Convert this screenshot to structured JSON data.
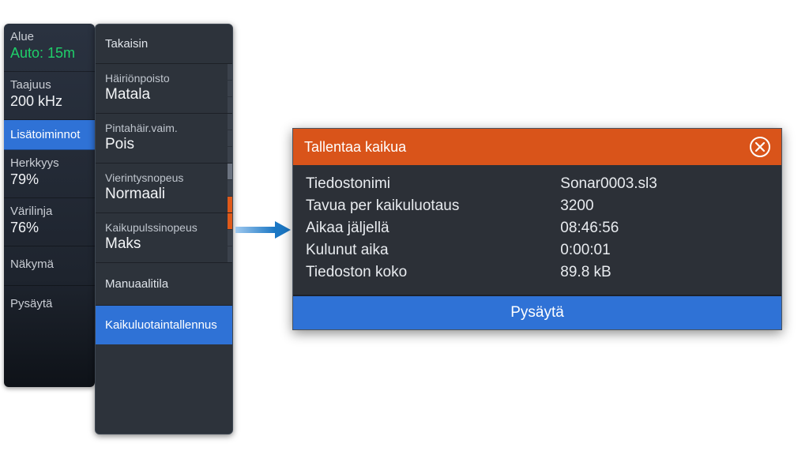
{
  "status": {
    "range": {
      "label": "Alue",
      "value": "Auto: 15m"
    },
    "freq": {
      "label": "Taajuus",
      "value": "200 kHz"
    },
    "more_label": "Lisätoiminnot",
    "sens": {
      "label": "Herkkyys",
      "value": "79%"
    },
    "color": {
      "label": "Värilinja",
      "value": "76%"
    },
    "view_label": "Näkymä",
    "stop_label": "Pysäytä"
  },
  "submenu": {
    "back": "Takaisin",
    "noise": {
      "label": "Häiriönpoisto",
      "value": "Matala"
    },
    "surf": {
      "label": "Pintahäir.vaim.",
      "value": "Pois"
    },
    "scroll": {
      "label": "Vierintysnopeus",
      "value": "Normaali"
    },
    "ping": {
      "label": "Kaikupulssinopeus",
      "value": "Maks"
    },
    "manual": "Manuaalitila",
    "record": "Kaikuluotaintallennus"
  },
  "dialog": {
    "title": "Tallentaa kaikua",
    "rows": [
      {
        "k": "Tiedostonimi",
        "v": "Sonar0003.sl3"
      },
      {
        "k": "Tavua per kaikuluotaus",
        "v": "3200"
      },
      {
        "k": "Aikaa jäljellä",
        "v": "08:46:56"
      },
      {
        "k": "Kulunut aika",
        "v": "0:00:01"
      },
      {
        "k": "Tiedoston koko",
        "v": "89.8 kB"
      }
    ],
    "stop": "Pysäytä"
  }
}
